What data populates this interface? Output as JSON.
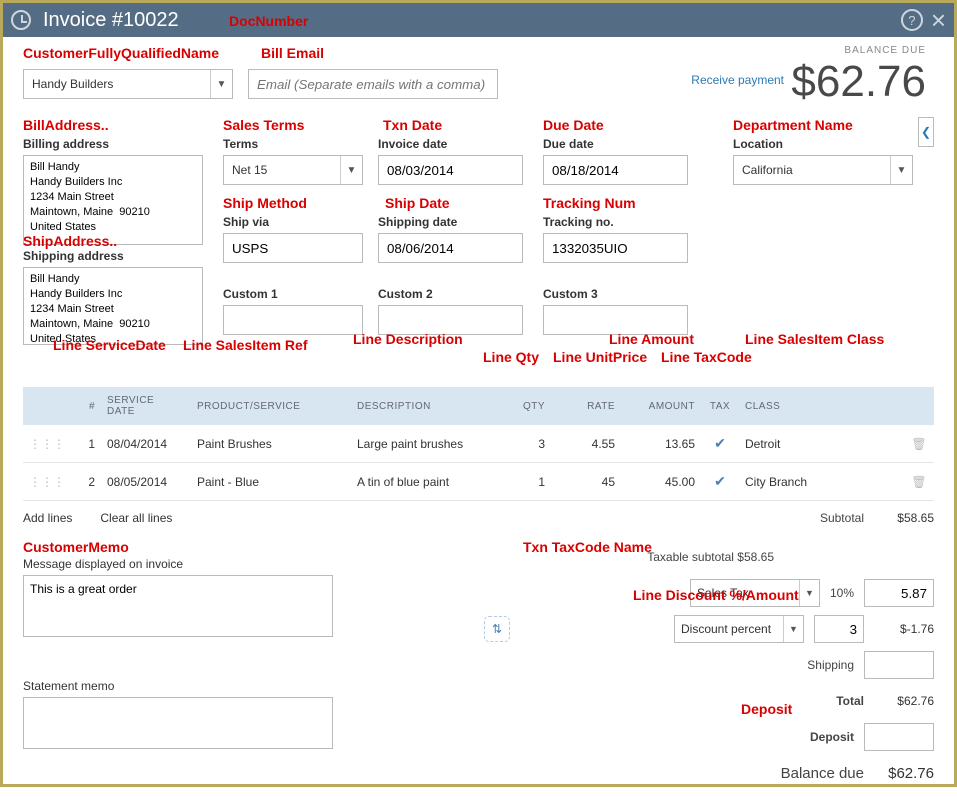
{
  "topbar": {
    "title": "Invoice #10022"
  },
  "annot": {
    "doc_number": "DocNumber",
    "cust_name": "CustomerFullyQualifiedName",
    "bill_email": "Bill Email",
    "bill_addr": "BillAddress..",
    "sales_terms": "Sales Terms",
    "txn_date": "Txn Date",
    "due_date": "Due Date",
    "dept_name": "Department Name",
    "ship_addr": "ShipAddress..",
    "ship_method": "Ship Method",
    "ship_date": "Ship Date",
    "tracking": "Tracking Num",
    "line_svc": "Line ServiceDate",
    "line_item": "Line SalesItem Ref",
    "line_desc": "Line Description",
    "line_qty": "Line Qty",
    "line_unit": "Line UnitPrice",
    "line_amt": "Line Amount",
    "line_tax": "Line TaxCode",
    "line_class": "Line SalesItem Class",
    "cust_memo": "CustomerMemo",
    "taxcode": "Txn TaxCode Name",
    "discount": "Line Discount %/Amount",
    "deposit": "Deposit"
  },
  "balance": {
    "label": "BALANCE DUE",
    "amount": "$62.76"
  },
  "receive_payment": "Receive payment",
  "customer": {
    "value": "Handy Builders"
  },
  "email": {
    "placeholder": "Email (Separate emails with a comma)"
  },
  "form": {
    "billing_label": "Billing address",
    "billing_addr": "Bill Handy\nHandy Builders Inc\n1234 Main Street\nMaintown, Maine  90210\nUnited States",
    "shipping_label": "Shipping address",
    "shipping_addr": "Bill Handy\nHandy Builders Inc\n1234 Main Street\nMaintown, Maine  90210\nUnited States",
    "terms_label": "Terms",
    "terms_value": "Net 15",
    "invoice_date_label": "Invoice date",
    "invoice_date": "08/03/2014",
    "due_date_label": "Due date",
    "due_date_value": "08/18/2014",
    "location_label": "Location",
    "location_value": "California",
    "shipvia_label": "Ship via",
    "shipvia_value": "USPS",
    "shipdate_label": "Shipping date",
    "shipdate_value": "08/06/2014",
    "tracking_label": "Tracking no.",
    "tracking_value": "1332035UIO",
    "custom1_label": "Custom 1",
    "custom2_label": "Custom 2",
    "custom3_label": "Custom 3"
  },
  "table": {
    "headers": {
      "num": "#",
      "svc": "SERVICE DATE",
      "prod": "PRODUCT/SERVICE",
      "desc": "DESCRIPTION",
      "qty": "QTY",
      "rate": "RATE",
      "amt": "AMOUNT",
      "tax": "TAX",
      "cls": "CLASS"
    },
    "rows": [
      {
        "num": "1",
        "svc": "08/04/2014",
        "prod": "Paint Brushes",
        "desc": "Large paint brushes",
        "qty": "3",
        "rate": "4.55",
        "amt": "13.65",
        "cls": "Detroit"
      },
      {
        "num": "2",
        "svc": "08/05/2014",
        "prod": "Paint - Blue",
        "desc": "A tin of blue paint",
        "qty": "1",
        "rate": "45",
        "amt": "45.00",
        "cls": "City Branch"
      }
    ]
  },
  "line_actions": {
    "add": "Add lines",
    "clear": "Clear all lines"
  },
  "memo": {
    "label": "Message displayed on invoice",
    "value": "This is a great order",
    "stmt_label": "Statement memo"
  },
  "totals": {
    "subtotal_label": "Subtotal",
    "subtotal_value": "$58.65",
    "taxable_label": "Taxable subtotal",
    "taxable_value": "$58.65",
    "tax_select": "Sales Tax",
    "tax_pct": "10%",
    "tax_amt": "5.87",
    "disc_select": "Discount percent",
    "disc_pct": "3",
    "disc_amt": "$-1.76",
    "shipping_label": "Shipping",
    "total_label": "Total",
    "total_value": "$62.76",
    "deposit_label": "Deposit",
    "balance_label": "Balance due",
    "balance_value": "$62.76"
  }
}
